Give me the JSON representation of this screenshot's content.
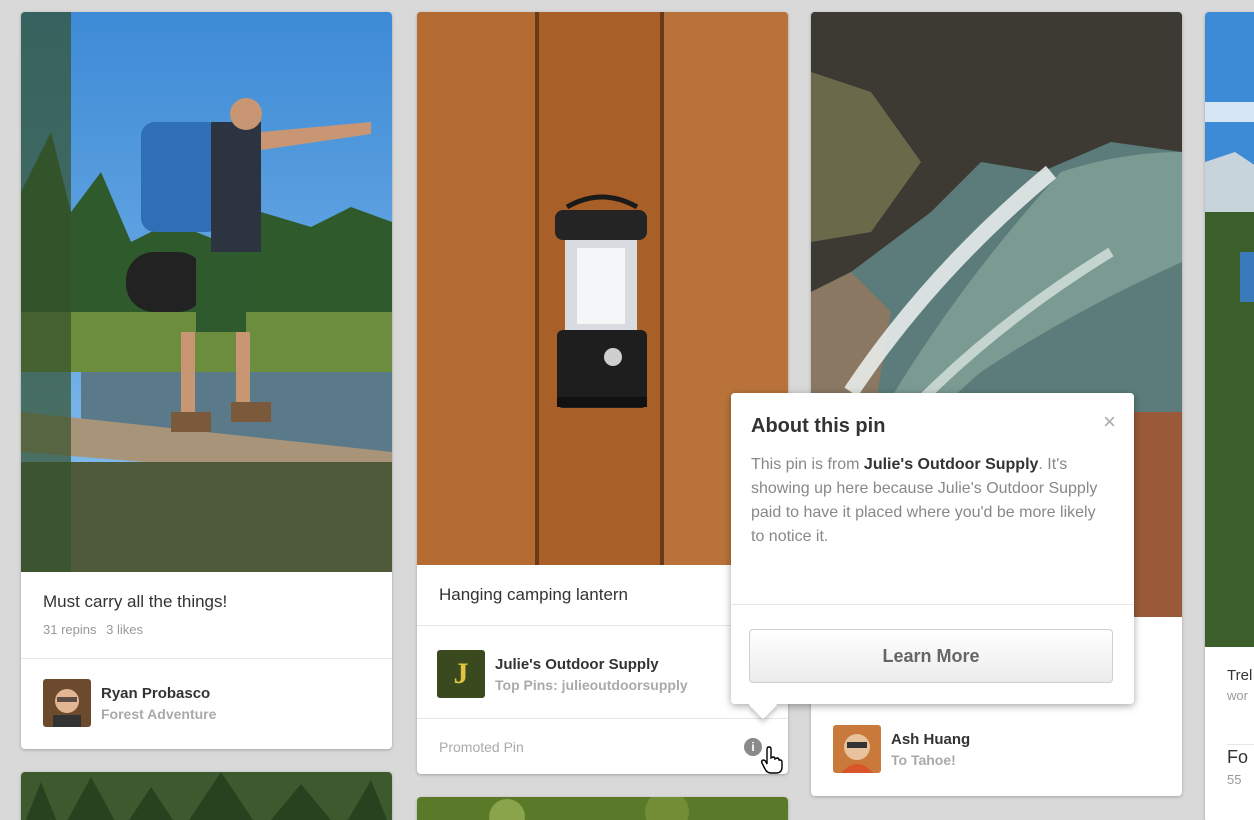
{
  "pins": [
    {
      "description": "Must carry all the things!",
      "repins": "31 repins",
      "likes": "3 likes",
      "pinner_name": "Ryan Probasco",
      "board_name": "Forest Adventure"
    },
    {
      "description": "Hanging camping lantern",
      "pinner_name": "Julie's Outdoor Supply",
      "board_name": "Top Pins: julieoutdoorsupply",
      "promoted_label": "Promoted Pin",
      "info_icon_glyph": "i"
    },
    {
      "pinner_name": "Ash Huang",
      "board_name": "To Tahoe!"
    },
    {
      "description_fragment": "Trel",
      "description_fragment_2": "wor",
      "pinner_fragment": "Fo",
      "stats_fragment": "55"
    }
  ],
  "popover": {
    "title": "About this pin",
    "close_glyph": "×",
    "body_intro": "This pin is from ",
    "advertiser": "Julie's Outdoor Supply",
    "body_rest": ". It's showing up here because Julie's Outdoor Supply paid to have it placed where you'd be more likely to notice it.",
    "learn_more_label": "Learn More"
  },
  "avatar_letter": "J",
  "colors": {
    "background": "#d9d9d9",
    "card": "#ffffff",
    "text_primary": "#333333",
    "text_muted": "#999999"
  },
  "icons": [
    "info-icon",
    "close-icon",
    "hand-cursor-icon"
  ]
}
